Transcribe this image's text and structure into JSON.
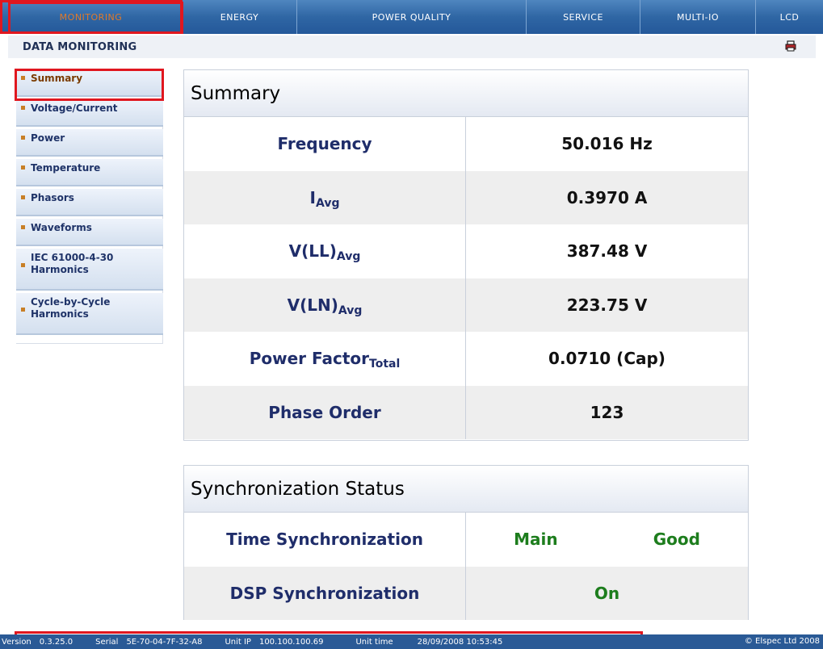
{
  "nav": {
    "tabs": [
      "MONITORING",
      "ENERGY",
      "POWER QUALITY",
      "SERVICE",
      "MULTI-IO",
      "LCD"
    ]
  },
  "header": {
    "title": "DATA MONITORING",
    "print_icon": "printer-icon"
  },
  "sidebar": {
    "items": [
      "Summary",
      "Voltage/Current",
      "Power",
      "Temperature",
      "Phasors",
      "Waveforms",
      "IEC 61000-4-30 Harmonics",
      "Cycle-by-Cycle Harmonics"
    ]
  },
  "summary": {
    "title": "Summary",
    "rows": [
      {
        "label": "Frequency",
        "sub": "",
        "value": "50.016 Hz"
      },
      {
        "label": "I",
        "sub": "Avg",
        "value": "0.3970 A"
      },
      {
        "label": "V(LL)",
        "sub": "Avg",
        "value": "387.48 V"
      },
      {
        "label": "V(LN)",
        "sub": "Avg",
        "value": "223.75 V"
      },
      {
        "label": "Power Factor",
        "sub": "Total",
        "value": "0.0710 (Cap)"
      },
      {
        "label": "Phase Order",
        "sub": "",
        "value": "123"
      }
    ]
  },
  "sync": {
    "title": "Synchronization Status",
    "rows": [
      {
        "label": "Time Synchronization",
        "v1": "Main",
        "v2": "Good"
      },
      {
        "label": "DSP Synchronization",
        "v1": "On"
      }
    ]
  },
  "footer": {
    "version_label": "Version",
    "version": "0.3.25.0",
    "serial_label": "Serial",
    "serial": "5E-70-04-7F-32-A8",
    "ip_label": "Unit IP",
    "ip": "100.100.100.69",
    "time_label": "Unit time",
    "time": "28/09/2008 10:53:45",
    "copyright": "© Elspec Ltd 2008"
  },
  "colors": {
    "nav_blue": "#2f66a4",
    "active_orange": "#e07a2a",
    "highlight_red": "#e0171f",
    "status_green": "#1d7d1d"
  }
}
